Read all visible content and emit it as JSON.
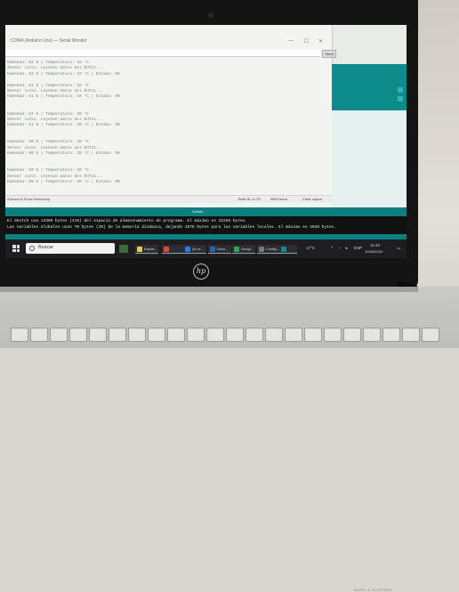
{
  "monitor": {
    "title": "COM4 (Arduino Uno) — Serial Monitor",
    "send_label": "Send",
    "lines": [
      "Humedad: 62 %  |  Temperatura: 19 °C",
      "Sensor listo. Leyendo datos del DHT11...",
      "Humedad: 62 %  |  Temperatura: 19 °C  |  Estado: OK",
      "",
      "Humedad: 61 %  |  Temperatura: 19 °C",
      "Sensor listo. Leyendo datos del DHT11...",
      "Humedad: 61 %  |  Temperatura: 19 °C  |  Estado: OK",
      "",
      "",
      "Humedad: 61 %  |  Temperatura: 20 °C",
      "Sensor listo. Leyendo datos del DHT11...",
      "Humedad: 61 %  |  Temperatura: 20 °C  |  Estado: OK",
      "",
      "",
      "Humedad: 60 %  |  Temperatura: 20 °C",
      "Sensor listo. Leyendo datos del DHT11...",
      "Humedad: 60 %  |  Temperatura: 20 °C  |  Estado: OK",
      "",
      "",
      "Humedad: 60 %  |  Temperatura: 20 °C",
      "Sensor listo. Leyendo datos del DHT11...",
      "Humedad: 60 %  |  Temperatura: 20 °C  |  Estado: OK"
    ],
    "autoscroll_label": "Autoscroll   Show timestamp",
    "line_ending": "Both NL & CR",
    "baud": "9600 baud",
    "clear_label": "Clear output"
  },
  "ide": {
    "band_text": "Subido"
  },
  "console": {
    "line1": "El Sketch usa 13309 bytes (41%) del espacio de almacenamiento de programa. El máximo es 32256 bytes.",
    "line2": "Las variables Globales usan 70 bytes (3%) de la memoria dinámica, dejando 1978 bytes para las variables locales. El máximo es 2048 bytes."
  },
  "taskbar": {
    "search_placeholder": "Buscar",
    "apps": [
      {
        "label": "Explor...",
        "color": "#f2c94c"
      },
      {
        "label": "",
        "color": "#e04a3a"
      },
      {
        "label": "(4) m...",
        "color": "#2d7be0"
      },
      {
        "label": "Docu...",
        "color": "#2b5fb8"
      },
      {
        "label": "Googl...",
        "color": "#34a853"
      },
      {
        "label": "Config...",
        "color": "#777777"
      },
      {
        "label": "",
        "color": "#0e8c8c"
      }
    ],
    "weather": "17°C",
    "lang": "ESP",
    "time": "11:43",
    "date": "10/06/2024"
  },
  "laptop": {
    "logo": "hp",
    "model": "BANG & OLUFSEN"
  }
}
